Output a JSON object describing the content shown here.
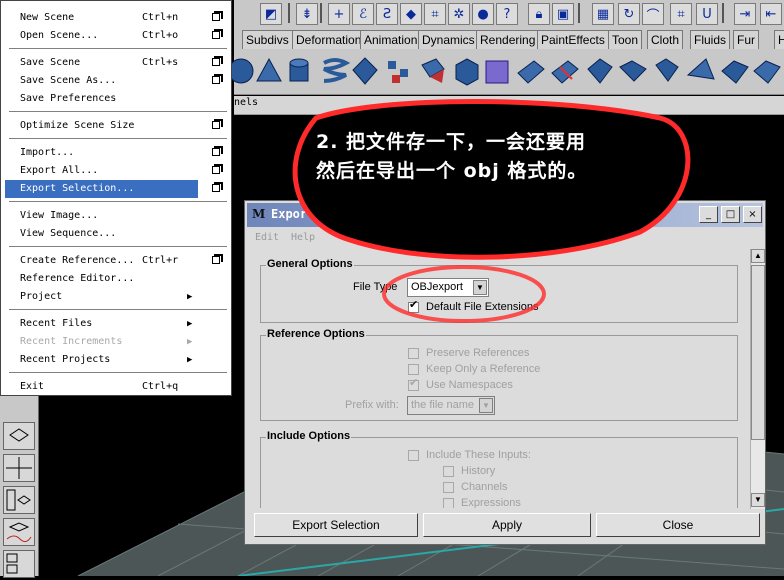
{
  "file_menu": {
    "items": [
      {
        "label": "New Scene",
        "shortcut": "Ctrl+n",
        "option_box": true
      },
      {
        "label": "Open Scene...",
        "shortcut": "Ctrl+o",
        "option_box": true
      },
      {
        "label": "Save Scene",
        "shortcut": "Ctrl+s",
        "option_box": true
      },
      {
        "label": "Save Scene As...",
        "shortcut": "",
        "option_box": true
      },
      {
        "label": "Save Preferences",
        "shortcut": "",
        "option_box": false
      },
      {
        "label": "Optimize Scene Size",
        "shortcut": "",
        "option_box": true
      },
      {
        "label": "Import...",
        "shortcut": "",
        "option_box": true
      },
      {
        "label": "Export All...",
        "shortcut": "",
        "option_box": true
      },
      {
        "label": "Export Selection...",
        "shortcut": "",
        "option_box": true,
        "selected": true
      },
      {
        "label": "View Image...",
        "shortcut": "",
        "option_box": false
      },
      {
        "label": "View Sequence...",
        "shortcut": "",
        "option_box": false
      },
      {
        "label": "Create Reference...",
        "shortcut": "Ctrl+r",
        "option_box": true
      },
      {
        "label": "Reference Editor...",
        "shortcut": "",
        "option_box": false
      },
      {
        "label": "Project",
        "shortcut": "",
        "submenu": true
      },
      {
        "label": "Recent Files",
        "shortcut": "",
        "submenu": true
      },
      {
        "label": "Recent Increments",
        "shortcut": "",
        "submenu": true,
        "disabled": true
      },
      {
        "label": "Recent Projects",
        "shortcut": "",
        "submenu": true
      },
      {
        "label": "Exit",
        "shortcut": "Ctrl+q",
        "option_box": false
      }
    ]
  },
  "shelf_tabs": [
    "Subdivs",
    "Deformation",
    "Animation",
    "Dynamics",
    "Rendering",
    "PaintEffects",
    "Toon",
    "Cloth",
    "Fluids",
    "Fur",
    "H"
  ],
  "panels_label": "nels",
  "dialog": {
    "title": "Export Selection Options",
    "menus": [
      "Edit",
      "Help"
    ],
    "title_buttons": [
      "_",
      "□",
      "×"
    ],
    "general": {
      "title": "General Options",
      "file_type_label": "File Type",
      "file_type_value": "OBJexport",
      "default_ext_label": "Default File Extensions",
      "default_ext_checked": true
    },
    "reference": {
      "title": "Reference Options",
      "preserve_label": "Preserve References",
      "keep_only_label": "Keep Only a Reference",
      "use_ns_label": "Use Namespaces",
      "prefix_label": "Prefix with:",
      "prefix_value": "the file name"
    },
    "include": {
      "title": "Include Options",
      "inputs_label": "Include These Inputs:",
      "history_label": "History",
      "channels_label": "Channels",
      "expressions_label": "Expressions"
    },
    "buttons": {
      "export": "Export Selection",
      "apply": "Apply",
      "close": "Close"
    }
  },
  "annotation": {
    "line1": "2. 把文件存一下，一会还要用",
    "line2": "然后在导出一个 obj 格式的。",
    "color": "#ff2a2a"
  },
  "colors": {
    "menu_highlight": "#3a6ec0",
    "title_gradient_start": "#6f86ba",
    "viewport_grid": "#5a6a6a"
  }
}
